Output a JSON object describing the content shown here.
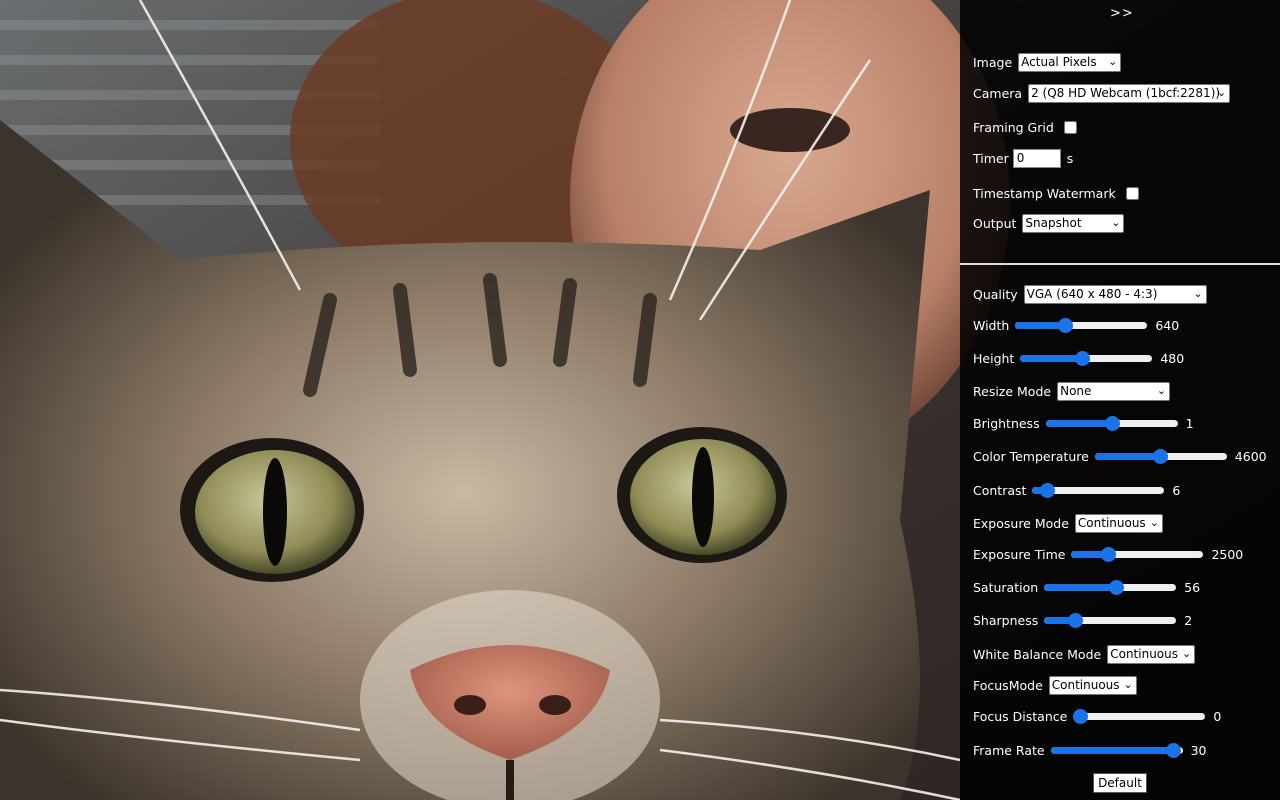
{
  "panel": {
    "toggle": ">>",
    "image": {
      "label": "Image",
      "value": "Actual Pixels"
    },
    "camera": {
      "label": "Camera",
      "value": "2 (Q8 HD Webcam (1bcf:2281))"
    },
    "framing_grid": {
      "label": "Framing Grid",
      "checked": false
    },
    "timer": {
      "label": "Timer",
      "value": "0",
      "unit": "s"
    },
    "timestamp_watermark": {
      "label": "Timestamp Watermark",
      "checked": false
    },
    "output": {
      "label": "Output",
      "value": "Snapshot"
    },
    "quality": {
      "label": "Quality",
      "value": "VGA (640 x 480 - 4:3)"
    },
    "width": {
      "label": "Width",
      "value": "640",
      "level": 0.36
    },
    "height": {
      "label": "Height",
      "value": "480",
      "level": 0.46
    },
    "resize_mode": {
      "label": "Resize Mode",
      "value": "None"
    },
    "brightness": {
      "label": "Brightness",
      "value": "1",
      "level": 0.5
    },
    "color_temperature": {
      "label": "Color Temperature",
      "value": "4600",
      "level": 0.49
    },
    "contrast": {
      "label": "Contrast",
      "value": "6",
      "level": 0.06
    },
    "exposure_mode": {
      "label": "Exposure Mode",
      "value": "Continuous"
    },
    "exposure_time": {
      "label": "Exposure Time",
      "value": "2500",
      "level": 0.25
    },
    "saturation": {
      "label": "Saturation",
      "value": "56",
      "level": 0.55
    },
    "sharpness": {
      "label": "Sharpness",
      "value": "2",
      "level": 0.2
    },
    "white_balance_mode": {
      "label": "White Balance Mode",
      "value": "Continuous"
    },
    "focus_mode": {
      "label": "FocusMode",
      "value": "Continuous"
    },
    "focus_distance": {
      "label": "Focus Distance",
      "value": "0",
      "level": 0.0
    },
    "frame_rate": {
      "label": "Frame Rate",
      "value": "30",
      "level": 0.98
    },
    "default_button": "Default"
  },
  "colors": {
    "accent": "#1a73e8",
    "panel_bg": "#000000"
  }
}
